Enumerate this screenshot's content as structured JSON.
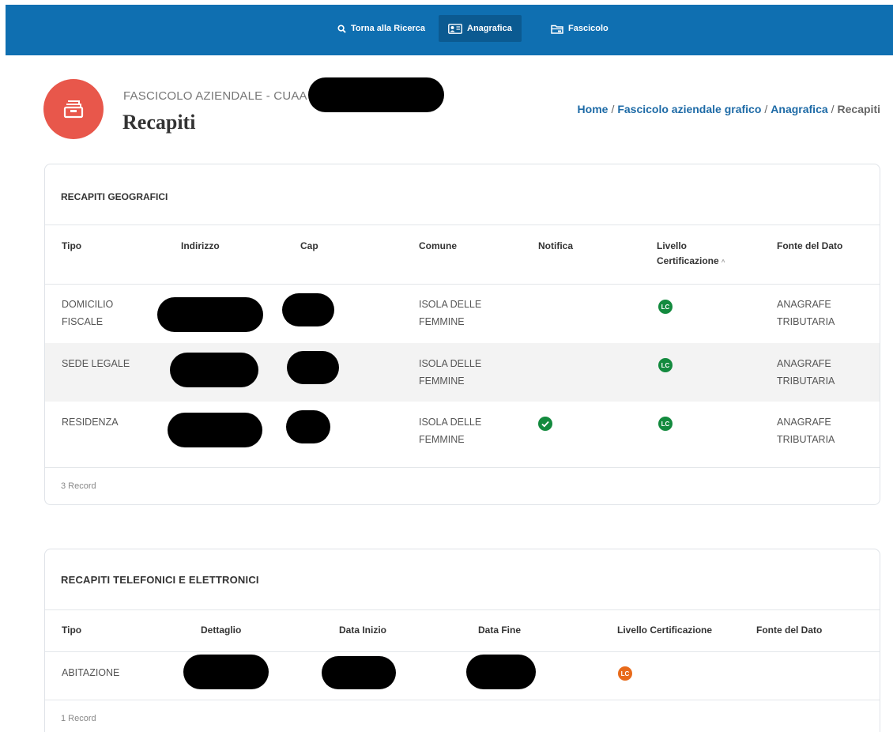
{
  "navbar": {
    "items": [
      {
        "label": "Torna alla Ricerca",
        "icon": "search-icon",
        "active": false
      },
      {
        "label": "Anagrafica",
        "icon": "id-card-icon",
        "active": true
      },
      {
        "label": "Fascicolo",
        "icon": "folder-icon",
        "active": false
      }
    ]
  },
  "header": {
    "subtitle": "FASCICOLO AZIENDALE - CUAA",
    "title": "Recapiti",
    "icon": "archive-icon"
  },
  "breadcrumb": {
    "items": [
      "Home",
      "Fascicolo aziendale grafico",
      "Anagrafica",
      "Recapiti"
    ],
    "separator": "/"
  },
  "geographic": {
    "title": "RECAPITI GEOGRAFICI",
    "columns": [
      "Tipo",
      "Indirizzo",
      "Cap",
      "Comune",
      "Notifica",
      "Livello Certificazione",
      "Fonte del Dato"
    ],
    "sort_indicator": "^",
    "rows": [
      {
        "tipo": "DOMICILIO FISCALE",
        "comune": "ISOLA DELLE FEMMINE",
        "notifica": false,
        "livello": "LC",
        "fonte": "ANAGRAFE TRIBUTARIA"
      },
      {
        "tipo": "SEDE LEGALE",
        "comune": "ISOLA DELLE FEMMINE",
        "notifica": false,
        "livello": "LC",
        "fonte": "ANAGRAFE TRIBUTARIA"
      },
      {
        "tipo": "RESIDENZA",
        "comune": "ISOLA DELLE FEMMINE",
        "notifica": true,
        "livello": "LC",
        "fonte": "ANAGRAFE TRIBUTARIA"
      }
    ],
    "footer": "3 Record"
  },
  "contacts": {
    "title": "RECAPITI TELEFONICI E ELETTRONICI",
    "columns": [
      "Tipo",
      "Dettaglio",
      "Data Inizio",
      "Data Fine",
      "Livello Certificazione",
      "Fonte del Dato"
    ],
    "rows": [
      {
        "tipo": "ABITAZIONE",
        "livello": "LC",
        "fonte": ""
      }
    ],
    "footer": "1 Record"
  },
  "colors": {
    "navbar": "#0f6fb1",
    "navbar_active": "#0b5a91",
    "header_icon_bg": "#e8574b",
    "link": "#1d6aa6",
    "badge_green": "#138a3e",
    "badge_orange": "#e86a1a"
  }
}
